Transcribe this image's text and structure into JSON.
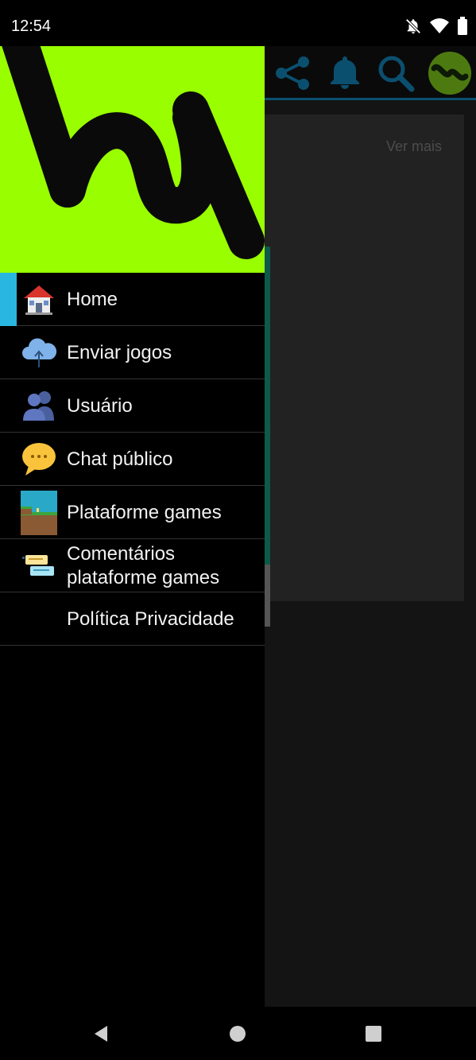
{
  "status_bar": {
    "time": "12:54",
    "icons": [
      "bell-off-icon",
      "wifi-icon",
      "battery-icon"
    ]
  },
  "app": {
    "toolbar_icons": [
      "share-icon",
      "bell-icon",
      "search-icon",
      "app-avatar-icon"
    ],
    "card": {
      "link_label": "Ver mais"
    }
  },
  "drawer": {
    "header_logo": "brand-logo",
    "selected_index": 0,
    "accent_color": "#29b6e0",
    "header_color": "#99ff00",
    "items": [
      {
        "label": "Home",
        "icon": "house-icon"
      },
      {
        "label": "Enviar jogos",
        "icon": "cloud-upload-icon"
      },
      {
        "label": "Usuário",
        "icon": "users-icon"
      },
      {
        "label": "Chat público",
        "icon": "speech-bubble-icon"
      },
      {
        "label": "Plataforme games",
        "icon": "platform-game-icon"
      },
      {
        "label_line1": "Comentários",
        "label_line2": "plataforme games",
        "icon": "comments-icon"
      },
      {
        "label": "Política Privacidade",
        "icon": null
      }
    ]
  },
  "nav_bar": {
    "buttons": [
      "back-icon",
      "home-circle-icon",
      "recents-icon"
    ]
  }
}
